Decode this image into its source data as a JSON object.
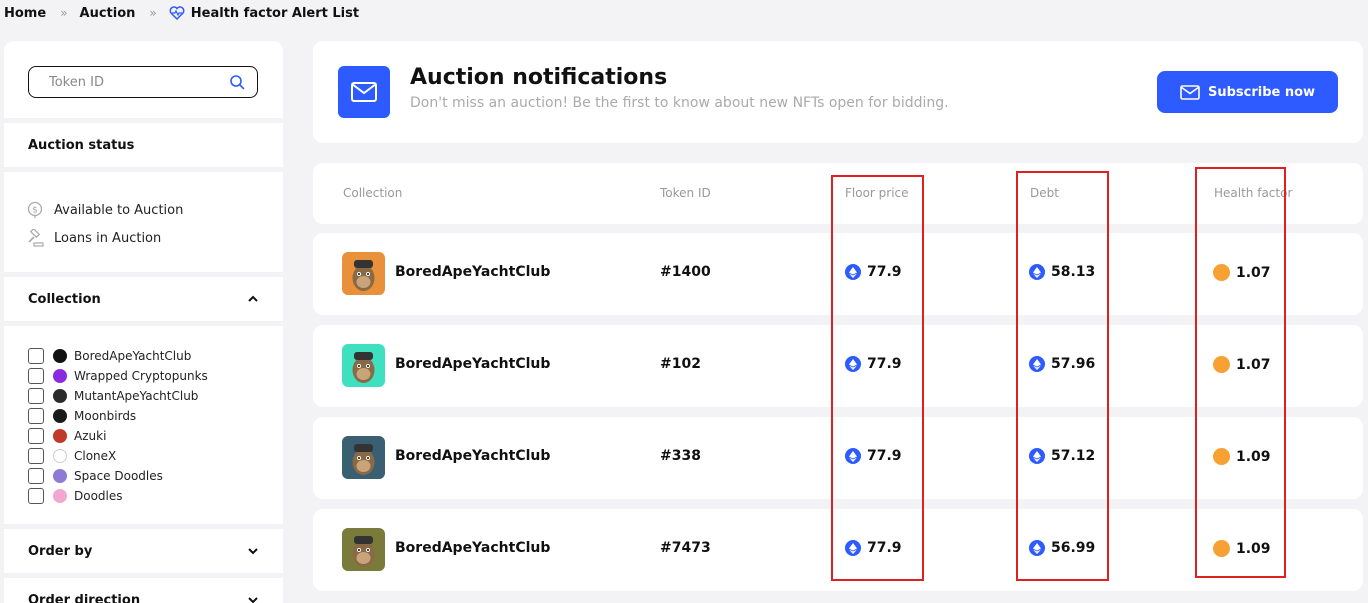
{
  "breadcrumb": {
    "home": "Home",
    "auction": "Auction",
    "current": "Health factor Alert List",
    "separator": "»"
  },
  "sidebar": {
    "search_placeholder": "Token ID",
    "auction_status_label": "Auction status",
    "status_items": [
      "Available to Auction",
      "Loans in Auction"
    ],
    "collection_label": "Collection",
    "collections": [
      {
        "name": "BoredApeYachtClub",
        "color": "#111111"
      },
      {
        "name": "Wrapped Cryptopunks",
        "color": "#8a2be2"
      },
      {
        "name": "MutantApeYachtClub",
        "color": "#2b2b2b"
      },
      {
        "name": "Moonbirds",
        "color": "#1a1a1a"
      },
      {
        "name": "Azuki",
        "color": "#c0392b"
      },
      {
        "name": "CloneX",
        "color": "#ffffff"
      },
      {
        "name": "Space Doodles",
        "color": "#8e7bd6"
      },
      {
        "name": "Doodles",
        "color": "#f3a6d0"
      }
    ],
    "order_by_label": "Order by",
    "order_direction_label": "Order direction"
  },
  "notification": {
    "title": "Auction notifications",
    "subtitle": "Don't miss an auction! Be the first to know about new NFTs open for bidding.",
    "subscribe_label": "Subscribe now"
  },
  "table": {
    "headers": {
      "collection": "Collection",
      "token_id": "Token ID",
      "floor_price": "Floor price",
      "debt": "Debt",
      "health_factor": "Health factor"
    },
    "rows": [
      {
        "collection": "BoredApeYachtClub",
        "token_id": "#1400",
        "floor_price": "77.9",
        "debt": "58.13",
        "health_factor": "1.07",
        "avatar_bg": "#e8913a"
      },
      {
        "collection": "BoredApeYachtClub",
        "token_id": "#102",
        "floor_price": "77.9",
        "debt": "57.96",
        "health_factor": "1.07",
        "avatar_bg": "#3fe0c0"
      },
      {
        "collection": "BoredApeYachtClub",
        "token_id": "#338",
        "floor_price": "77.9",
        "debt": "57.12",
        "health_factor": "1.09",
        "avatar_bg": "#3a5f73"
      },
      {
        "collection": "BoredApeYachtClub",
        "token_id": "#7473",
        "floor_price": "77.9",
        "debt": "56.99",
        "health_factor": "1.09",
        "avatar_bg": "#7a7a3a"
      }
    ]
  },
  "colors": {
    "accent": "#2d5bff",
    "health_dot": "#f7a034",
    "highlight": "#e02020"
  }
}
